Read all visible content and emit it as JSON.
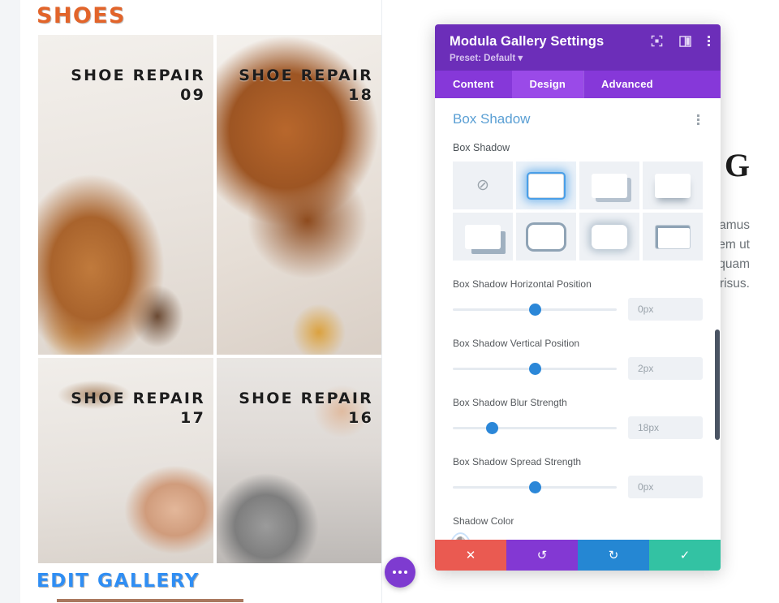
{
  "page": {
    "gallery_title": "SHOES",
    "edit_gallery_label": "EDIT GALLERY",
    "tiles": [
      {
        "caption": "SHOE REPAIR 09",
        "photo": "brown-leather-shoe-with-thread-spools"
      },
      {
        "caption": "SHOE REPAIR 18",
        "photo": "pair-of-brown-leather-shoes-closeup"
      },
      {
        "caption": "SHOE REPAIR 17",
        "photo": "hands-stitching-shoe-sole"
      },
      {
        "caption": "SHOE REPAIR 16",
        "photo": "hand-brushing-grey-suede-shoe"
      }
    ],
    "side_heading": "G",
    "side_body_lines": [
      "amus",
      "rem ut",
      "quam",
      "risus."
    ],
    "fab_label": "page-settings-menu"
  },
  "modal": {
    "title": "Modula Gallery Settings",
    "preset_label": "Preset: Default",
    "preset_caret": "▾",
    "header_icons": [
      "expand-icon",
      "split-view-icon",
      "more-options-icon"
    ],
    "tabs": [
      {
        "label": "Content",
        "active": false
      },
      {
        "label": "Design",
        "active": true
      },
      {
        "label": "Advanced",
        "active": false
      }
    ],
    "section": {
      "title": "Box Shadow",
      "menu_icon": "section-options-icon"
    },
    "box_shadow": {
      "label": "Box Shadow",
      "selected_index": 1,
      "presets": [
        {
          "name": "none",
          "icon": "no-shadow-icon"
        },
        {
          "name": "outline",
          "icon": "shadow-outline"
        },
        {
          "name": "offset-hard",
          "icon": "shadow-offset-hard"
        },
        {
          "name": "soft-drop",
          "icon": "shadow-soft-drop"
        },
        {
          "name": "offset-large",
          "icon": "shadow-offset-large"
        },
        {
          "name": "thick-border",
          "icon": "shadow-thick-border"
        },
        {
          "name": "inner-glow",
          "icon": "shadow-inner-glow"
        },
        {
          "name": "corner-inset",
          "icon": "shadow-corner-inset"
        }
      ]
    },
    "sliders": [
      {
        "label": "Box Shadow Horizontal Position",
        "value": "0px",
        "percent": 50
      },
      {
        "label": "Box Shadow Vertical Position",
        "value": "2px",
        "percent": 50
      },
      {
        "label": "Box Shadow Blur Strength",
        "value": "18px",
        "percent": 24
      },
      {
        "label": "Box Shadow Spread Strength",
        "value": "0px",
        "percent": 50
      }
    ],
    "shadow_color": {
      "label": "Shadow Color",
      "custom_swatch": {
        "name": "eyedropper-custom-color",
        "icon": "eyedropper-icon",
        "selected": true
      },
      "swatches": [
        {
          "name": "black",
          "hex": "#000000"
        },
        {
          "name": "white",
          "hex": "#ffffff"
        },
        {
          "name": "red",
          "hex": "#e02b20"
        },
        {
          "name": "orange",
          "hex": "#e09900"
        },
        {
          "name": "yellow",
          "hex": "#edf000"
        },
        {
          "name": "green",
          "hex": "#7cda24"
        },
        {
          "name": "blue",
          "hex": "#0c71c3"
        },
        {
          "name": "purple",
          "hex": "#8300e9"
        },
        {
          "name": "transparent",
          "hex": "transparent"
        }
      ]
    },
    "footer_buttons": [
      {
        "name": "discard",
        "icon": "✕",
        "color": "#ea5a51"
      },
      {
        "name": "undo",
        "icon": "↺",
        "color": "#8338d3"
      },
      {
        "name": "redo",
        "icon": "↻",
        "color": "#2587d3"
      },
      {
        "name": "save",
        "icon": "✓",
        "color": "#33c2a3"
      }
    ]
  },
  "colors": {
    "modal_header": "#6c2eb9",
    "tab_bar": "#8638d9",
    "tab_active": "#9a4ae8",
    "section_title": "#5a9fd4",
    "slider_accent": "#2b87d8",
    "gallery_title": "#e2642a",
    "edit_link": "#2f8ef4"
  }
}
